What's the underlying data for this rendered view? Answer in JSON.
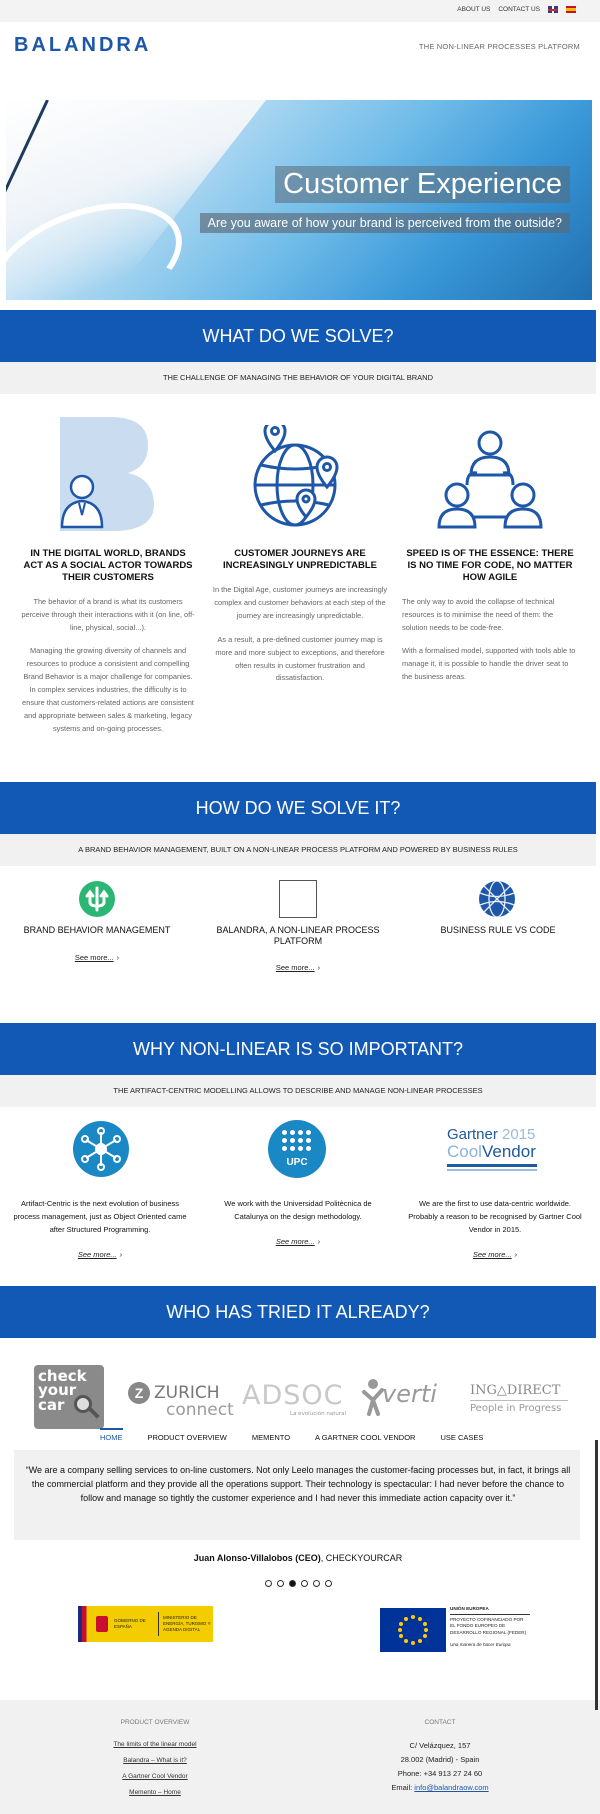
{
  "topnav": {
    "about": "ABOUT US",
    "contact": "CONTACT US",
    "lang_en_icon": "uk-flag-icon",
    "lang_es_icon": "spain-flag-icon"
  },
  "header": {
    "logo": "BALANDRA",
    "tagline": "THE NON-LINEAR PROCESSES PLATFORM"
  },
  "hero": {
    "title": "Customer Experience",
    "subtitle": "Are you aware of how your brand is perceived from the outside?"
  },
  "solve": {
    "heading": "WHAT DO WE SOLVE?",
    "subheading": "THE  CHALLENGE OF MANAGING THE BEHAVIOR OF YOUR DIGITAL BRAND",
    "columns": [
      {
        "icon": "businessman-b-icon",
        "title": "IN THE DIGITAL WORLD, BRANDS ACT AS A SOCIAL ACTOR TOWARDS THEIR CUSTOMERS",
        "p1": "The behavior of a brand is what its customers perceive through their interactions with it (on line, off-line, physical, social...).",
        "p2": "Managing the growing diversity of channels and resources to produce a consistent and compelling Brand Behavior is a major challenge for companies. In complex services industries, the difficulty is to ensure that customers-related actions are consistent and appropriate between sales & marketing, legacy systems and on-going processes."
      },
      {
        "icon": "globe-pins-icon",
        "title": "CUSTOMER JOURNEYS ARE INCREASINGLY UNPREDICTABLE",
        "p1": "In the Digital Age, customer journeys are increasingly complex and customer behaviors at each step of the journey are increasingly unpredictable.",
        "p2": "As a result, a pre-defined customer journey map is more and more subject to exceptions, and therefore often results in customer frustration and dissatisfaction."
      },
      {
        "icon": "team-network-icon",
        "title": "SPEED IS OF THE ESSENCE: THERE IS NO TIME FOR CODE, NO MATTER HOW AGILE",
        "p1": "The only way to avoid the collapse of technical resources is to minimise the need of them: the solution needs to be code-free.",
        "p2": "With a formalised model, supported with tools able to manage it, it is possible to handle the driver seat to the business areas."
      }
    ]
  },
  "how": {
    "heading": "HOW DO WE SOLVE IT?",
    "subheading": "A BRAND BEHAVIOR MANAGEMENT, BUILT ON A NON-LINEAR PROCESS  PLATFORM  AND POWERED BY BUSINESS RULES",
    "items": [
      {
        "icon": "green-arrows-icon",
        "title": "BRAND BEHAVIOR MANAGEMENT",
        "link": "See more..."
      },
      {
        "icon": "blank-image-icon",
        "title": "BALANDRA, A NON-LINEAR PROCESS PLATFORM",
        "link": "See more..."
      },
      {
        "icon": "blue-globe-icon",
        "title": "BUSINESS RULE VS CODE",
        "link": ""
      }
    ]
  },
  "why": {
    "heading": "WHY NON-LINEAR IS SO IMPORTANT?",
    "subheading": "THE ARTIFACT-CENTRIC MODELLING ALLOWS TO DESCRIBE AND MANAGE NON-LINEAR PROCESSES",
    "items": [
      {
        "icon": "network-node-icon",
        "text": "Artifact-Centric is the next evolution of business process management, just as Object Oriented came after Structured Programming.",
        "link": "See more..."
      },
      {
        "icon": "upc-logo-icon",
        "text": "We work with the Universidad Politècnica de Catalunya on the design methodology.",
        "link": "See more...",
        "upc_label": "UPC"
      },
      {
        "icon": "gartner-logo-icon",
        "text": "We are the first to use data-centric worldwide. Probably a reason to be recognised by Gartner Cool Vendor in 2015.",
        "link": "See more...",
        "gartner_name": "Gartner",
        "gartner_year": "2015",
        "gartner_cool": "Cool",
        "gartner_vendor": "Vendor"
      }
    ]
  },
  "tried": {
    "heading": "WHO HAS TRIED IT ALREADY?",
    "logos": {
      "checkyourcar": [
        "check",
        "your",
        "car"
      ],
      "zurich": "ZURICH",
      "zurich_sub": "connect",
      "adsoc": "ADSOC",
      "adsoc_sub": "La evolución natural",
      "verti": "verti",
      "ing": "ING",
      "ing_direct": "DIRECT",
      "ing_sub": "People in Progress"
    }
  },
  "tabs": [
    "HOME",
    "PRODUCT OVERVIEW",
    "MEMENTO",
    "A GARTNER COOL VENDOR",
    "USE CASES"
  ],
  "testimonial": {
    "quote": "“We are a company selling services to on-line customers. Not only Leelo manages the customer-facing processes but, in fact, it brings all the commercial platform and they provide all the operations support. Their technology is spectacular: I had never before the chance to follow and manage so tightly the customer experience and I had never this immediate action capacity over it.”",
    "author_name": "Juan Alonso-Villalobos (CEO)",
    "author_company": ", CHECKYOURCAR",
    "active_dot": 3,
    "dot_count": 6
  },
  "funding": {
    "spain": {
      "gobierno": "GOBIERNO DE ESPAÑA",
      "ministerio": "MINISTERIO DE ENERGÍA, TURISMO Y AGENDA DIGITAL"
    },
    "eu": {
      "title": "UNIÓN EUROPEA",
      "text": "PROYECTO COFINANCIADO POR EL FONDO EUROPEO DE DESARROLLO REGIONAL (FEDER)",
      "motto": "Una manera de hacer Europa"
    }
  },
  "footer": {
    "product_heading": "PRODUCT OVERVIEW",
    "links": [
      "The limits of the linear model",
      "Balandra – What is it?",
      "A Gartner Cool Vendor",
      "Memento – Home"
    ],
    "contact_heading": "CONTACT",
    "address1": "C/ Velázquez, 157",
    "address2": "28.002 (Madrid) - Spain",
    "phone": "Phone: +34 913 27 24 60",
    "email_label": "Email: ",
    "email": "info@balandraow.com"
  },
  "colors": {
    "brand_blue": "#1259b5",
    "band_grey": "#f1f1f1",
    "accent_green": "#2bb673"
  }
}
